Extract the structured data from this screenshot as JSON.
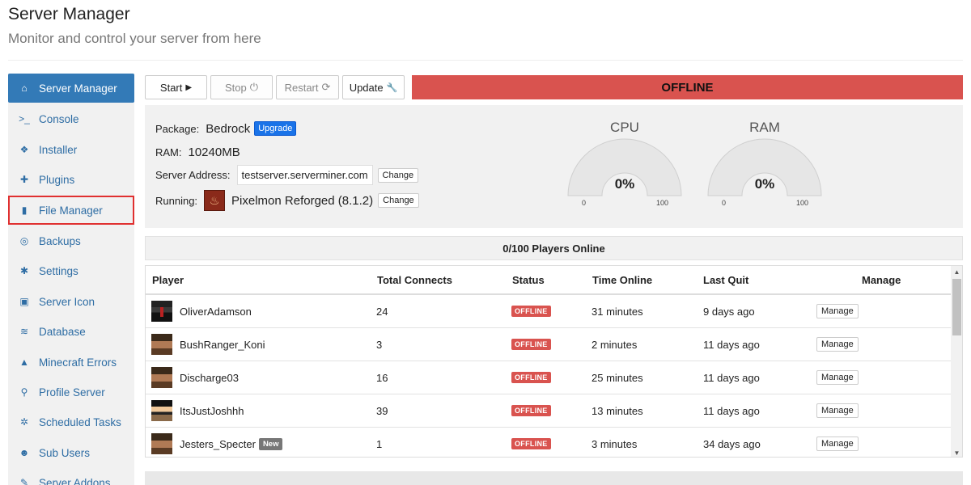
{
  "header": {
    "title": "Server Manager",
    "subtitle": "Monitor and control your server from here"
  },
  "sidebar": {
    "items": [
      {
        "label": "Server Manager",
        "icon": "home-icon",
        "glyph": "⌂"
      },
      {
        "label": "Console",
        "icon": "terminal-icon",
        "glyph": ">_"
      },
      {
        "label": "Installer",
        "icon": "cubes-icon",
        "glyph": "❖"
      },
      {
        "label": "Plugins",
        "icon": "puzzle-icon",
        "glyph": "✚"
      },
      {
        "label": "File Manager",
        "icon": "file-icon",
        "glyph": "▮"
      },
      {
        "label": "Backups",
        "icon": "lifebuoy-icon",
        "glyph": "◎"
      },
      {
        "label": "Settings",
        "icon": "gear-icon",
        "glyph": "✱"
      },
      {
        "label": "Server Icon",
        "icon": "image-icon",
        "glyph": "▣"
      },
      {
        "label": "Database",
        "icon": "database-icon",
        "glyph": "≋"
      },
      {
        "label": "Minecraft Errors",
        "icon": "warning-icon",
        "glyph": "▲"
      },
      {
        "label": "Profile Server",
        "icon": "search-icon",
        "glyph": "⚲"
      },
      {
        "label": "Scheduled Tasks",
        "icon": "cogs-icon",
        "glyph": "✲"
      },
      {
        "label": "Sub Users",
        "icon": "users-icon",
        "glyph": "☻"
      },
      {
        "label": "Server Addons",
        "icon": "addons-icon",
        "glyph": "✎"
      }
    ]
  },
  "toolbar": {
    "start": "Start",
    "start_glyph": "▶",
    "stop": "Stop",
    "stop_glyph": "⏻",
    "restart": "Restart",
    "restart_glyph": "⟳",
    "update": "Update",
    "update_glyph": "🔧",
    "status": "OFFLINE"
  },
  "info": {
    "package_label": "Package:",
    "package_value": "Bedrock",
    "upgrade_label": "Upgrade",
    "ram_label": "RAM:",
    "ram_value": "10240MB",
    "address_label": "Server Address:",
    "address_value": "testserver.serverminer.com",
    "change_label": "Change",
    "running_label": "Running:",
    "running_value": "Pixelmon Reforged (8.1.2)",
    "running_change_label": "Change"
  },
  "gauges": {
    "cpu": {
      "title": "CPU",
      "value": "0%",
      "level": 0,
      "min": "0",
      "max": "100"
    },
    "ram": {
      "title": "RAM",
      "value": "0%",
      "level": 0,
      "min": "0",
      "max": "100"
    }
  },
  "players": {
    "summary": "0/100 Players Online",
    "columns": [
      "Player",
      "Total Connects",
      "Status",
      "Time Online",
      "Last Quit",
      "Manage"
    ],
    "rows": [
      {
        "name": "OliverAdamson",
        "connects": "24",
        "status": "OFFLINE",
        "time": "31 minutes",
        "last_quit": "9 days ago",
        "manage": "Manage",
        "badge": ""
      },
      {
        "name": "BushRanger_Koni",
        "connects": "3",
        "status": "OFFLINE",
        "time": "2 minutes",
        "last_quit": "11 days ago",
        "manage": "Manage",
        "badge": ""
      },
      {
        "name": "Discharge03",
        "connects": "16",
        "status": "OFFLINE",
        "time": "25 minutes",
        "last_quit": "11 days ago",
        "manage": "Manage",
        "badge": ""
      },
      {
        "name": "ItsJustJoshhh",
        "connects": "39",
        "status": "OFFLINE",
        "time": "13 minutes",
        "last_quit": "11 days ago",
        "manage": "Manage",
        "badge": ""
      },
      {
        "name": "Jesters_Specter",
        "connects": "1",
        "status": "OFFLINE",
        "time": "3 minutes",
        "last_quit": "34 days ago",
        "manage": "Manage",
        "badge": "New"
      }
    ]
  },
  "colors": {
    "accent": "#337ab7",
    "offline": "#d9534f",
    "upgrade": "#1a73e8"
  }
}
